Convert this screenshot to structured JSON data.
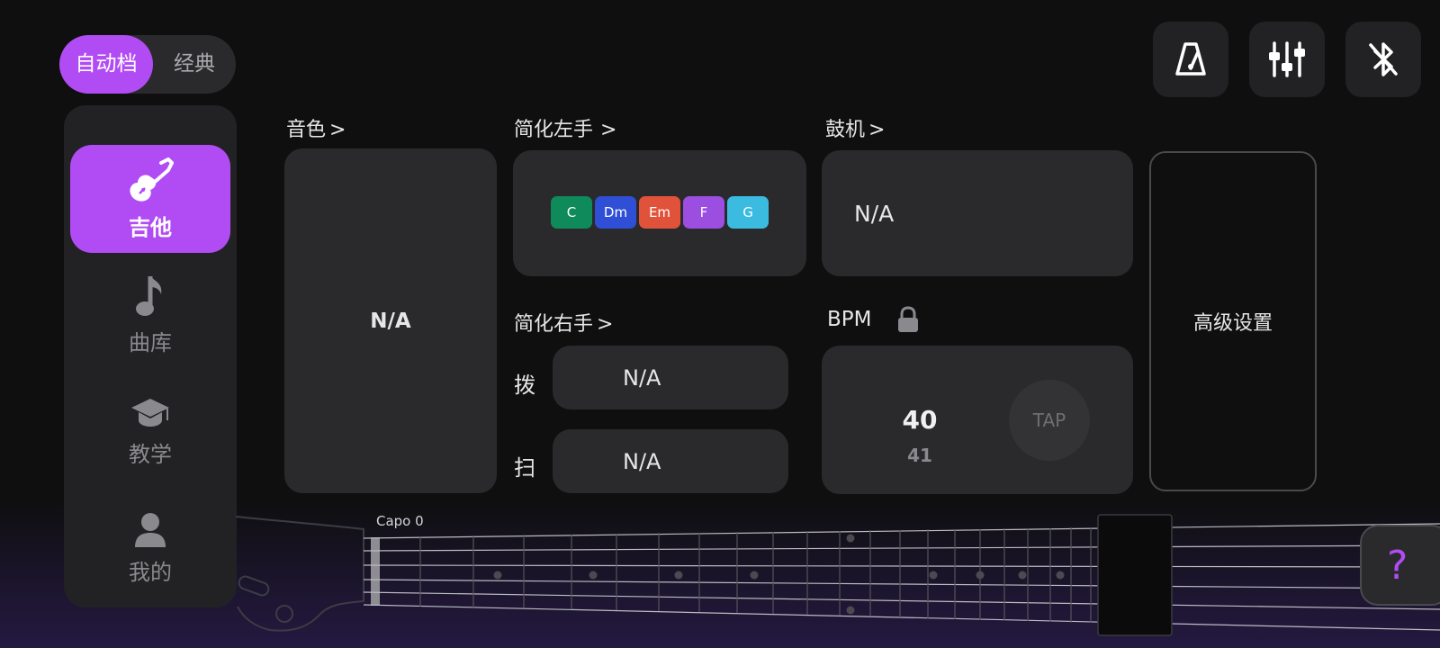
{
  "mode_toggle": {
    "auto": "自动档",
    "classic": "经典"
  },
  "top_icons": {
    "metronome": "metronome-icon",
    "mixer": "mixer-sliders-icon",
    "bluetooth": "bluetooth-off-icon"
  },
  "sidebar": {
    "items": [
      {
        "label": "吉他",
        "icon": "guitar-icon",
        "active": true
      },
      {
        "label": "曲库",
        "icon": "music-note-icon",
        "active": false
      },
      {
        "label": "教学",
        "icon": "graduation-cap-icon",
        "active": false
      },
      {
        "label": "我的",
        "icon": "user-icon",
        "active": false
      }
    ]
  },
  "tone": {
    "title": "音色",
    "value": "N/A"
  },
  "left_hand": {
    "title": "简化左手",
    "chords": [
      {
        "name": "C",
        "color": "#0f8a5a"
      },
      {
        "name": "Dm",
        "color": "#2e4fd6"
      },
      {
        "name": "Em",
        "color": "#e0533a"
      },
      {
        "name": "F",
        "color": "#9b4ee0"
      },
      {
        "name": "G",
        "color": "#3bbbe0"
      }
    ]
  },
  "right_hand": {
    "title": "简化右手",
    "pluck_label": "拨",
    "pluck_value": "N/A",
    "strum_label": "扫",
    "strum_value": "N/A"
  },
  "drum": {
    "title": "鼓机",
    "value": "N/A"
  },
  "bpm": {
    "title": "BPM",
    "value": "40",
    "next": "41",
    "tap": "TAP",
    "locked": true
  },
  "advanced": {
    "label": "高级设置"
  },
  "fretboard": {
    "capo": "Capo 0"
  },
  "help": {
    "label": "?"
  },
  "colors": {
    "accent": "#b14cf4",
    "card": "#2a2a2c",
    "background": "#0f0f10"
  }
}
